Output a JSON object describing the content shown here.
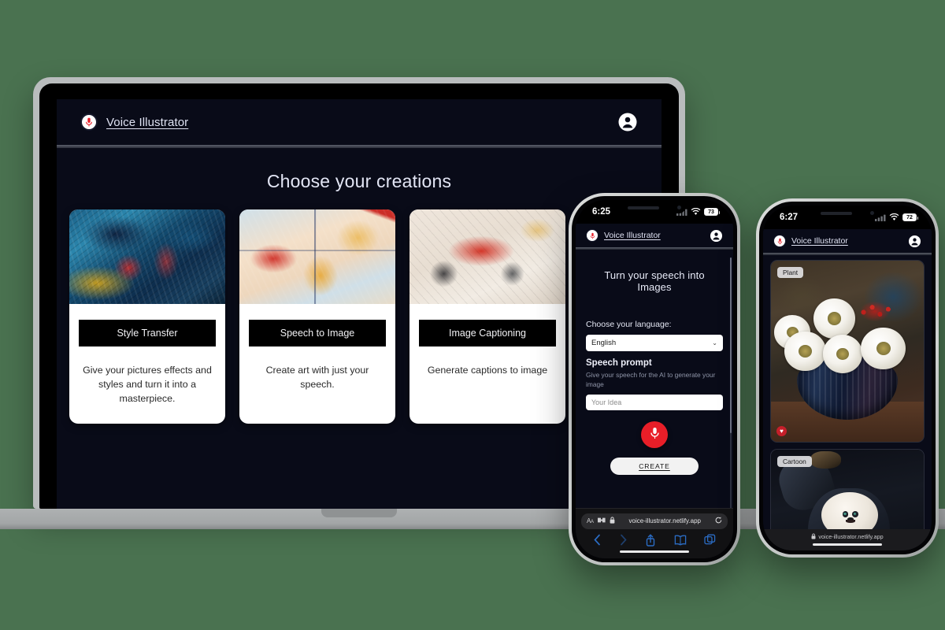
{
  "background_color": "#4a7250",
  "brand": {
    "name": "Voice Illustrator",
    "logo_icon": "microphone-icon",
    "logo_accent": "#e81e28",
    "account_icon": "account-circle-icon"
  },
  "laptop": {
    "page_title": "Choose your creations",
    "cards": [
      {
        "button_label": "Style Transfer",
        "description": "Give your pictures effects and styles and turn it into a masterpiece.",
        "thumbnail": "blue-abstract-painting"
      },
      {
        "button_label": "Speech to Image",
        "description": "Create art with just your speech.",
        "thumbnail": "pastel-abstract-painting"
      },
      {
        "button_label": "Image Captioning",
        "description": "Generate captions to image",
        "thumbnail": "red-cream-abstract-painting"
      }
    ]
  },
  "phone_middle": {
    "status": {
      "time": "6:25",
      "wifi_icon": "wifi-icon",
      "cellular_icon": "cellular-bars-icon",
      "battery": "73"
    },
    "screen_title": "Turn your speech into Images",
    "language_label": "Choose your language:",
    "language_value": "English",
    "language_options": [
      "English"
    ],
    "prompt_label": "Speech prompt",
    "prompt_hint": "Give your speech for the AI to generate your image",
    "prompt_placeholder": "Your Idea",
    "mic_icon": "microphone-icon",
    "mic_color": "#e81e28",
    "create_label": "CREATE",
    "safari": {
      "text_size_icon": "aa-text-size-icon",
      "extensions_icon": "puzzle-extension-icon",
      "lock_icon": "lock-icon",
      "url": "voice-illustrator.netlify.app",
      "reload_icon": "reload-icon",
      "back_icon": "chevron-left-icon",
      "forward_icon": "chevron-right-icon",
      "share_icon": "share-icon",
      "bookmarks_icon": "book-icon",
      "tabs_icon": "tabs-icon"
    }
  },
  "phone_right": {
    "status": {
      "time": "6:27",
      "wifi_icon": "wifi-icon",
      "cellular_icon": "cellular-bars-icon",
      "battery": "72"
    },
    "gallery": [
      {
        "tag": "Plant",
        "image": "white-flowers-in-dark-vase-painting",
        "favorite_icon": "heart-icon",
        "favorite_color": "#c51f2a"
      },
      {
        "tag": "Cartoon",
        "image": "cartoon-panda-character"
      }
    ],
    "safari": {
      "lock_icon": "lock-icon",
      "url": "voice-illustrator.netlify.app"
    }
  }
}
